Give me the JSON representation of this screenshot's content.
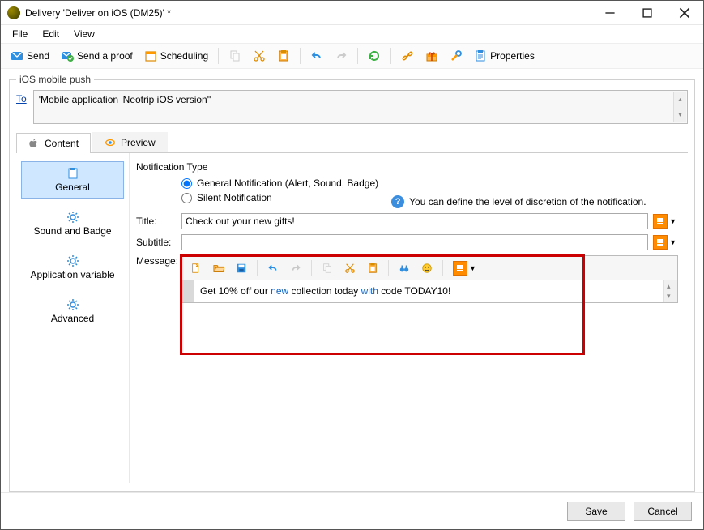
{
  "window": {
    "title": "Delivery 'Deliver on iOS (DM25)' *"
  },
  "menu": {
    "file": "File",
    "edit": "Edit",
    "view": "View"
  },
  "toolbar": {
    "send": "Send",
    "send_proof": "Send a proof",
    "scheduling": "Scheduling",
    "properties": "Properties"
  },
  "group": {
    "legend": "iOS mobile push",
    "to_label": "To",
    "to_value": "'Mobile application 'Neotrip iOS version''"
  },
  "tabs": {
    "content": "Content",
    "preview": "Preview"
  },
  "vnav": {
    "general": "General",
    "sound_badge": "Sound and Badge",
    "app_var": "Application variable",
    "advanced": "Advanced"
  },
  "form": {
    "notif_type_label": "Notification Type",
    "radio_general": "General Notification (Alert, Sound, Badge)",
    "radio_silent": "Silent Notification",
    "hint": "You can define the level of discretion of the notification.",
    "title_label": "Title:",
    "title_value": "Check out your new gifts!",
    "subtitle_label": "Subtitle:",
    "subtitle_value": "",
    "message_label": "Message:",
    "message_plain_1": "Get 10% off our ",
    "message_kw_1": "new",
    "message_plain_2": " collection today ",
    "message_kw_2": "with",
    "message_plain_3": " code TODAY10!"
  },
  "footer": {
    "save": "Save",
    "cancel": "Cancel"
  }
}
